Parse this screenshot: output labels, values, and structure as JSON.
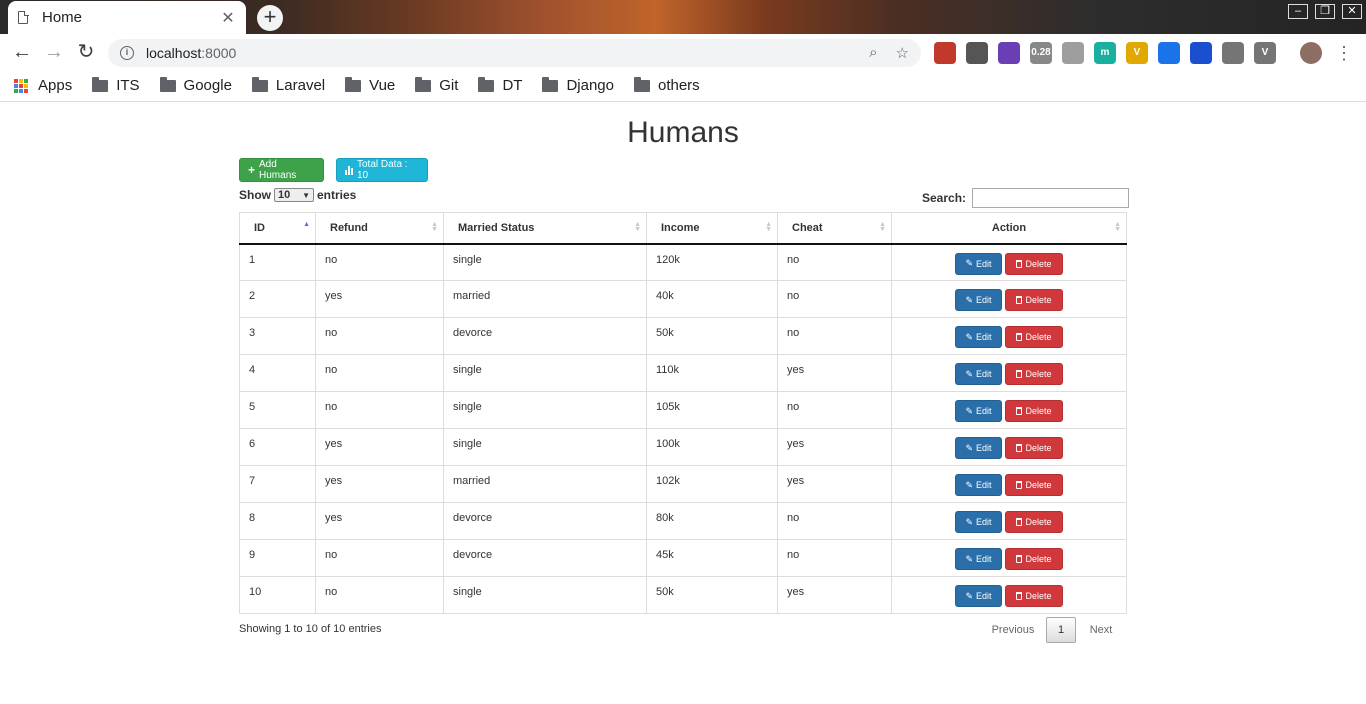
{
  "browser": {
    "tab_title": "Home",
    "tab_close": "✕",
    "new_tab": "+",
    "url_host": "localhost",
    "url_port": ":8000",
    "window_controls": [
      "–",
      "❐",
      "✕"
    ],
    "extensions": [
      {
        "icon": "ublock-icon",
        "color": "#c0392b",
        "label": ""
      },
      {
        "icon": "pen-icon",
        "color": "#555555",
        "label": ""
      },
      {
        "icon": "purple-ext-icon",
        "color": "#6a3fb5",
        "label": ""
      },
      {
        "icon": "counter-ext-icon",
        "color": "#888888",
        "label": "0.28"
      },
      {
        "icon": "cloud-ext-icon",
        "color": "#9e9e9e",
        "label": ""
      },
      {
        "icon": "m-ext-icon",
        "color": "#1ab0a0",
        "label": "m"
      },
      {
        "icon": "vue-devtools-icon",
        "color": "#e0a800",
        "label": "V"
      },
      {
        "icon": "eyedropper-icon",
        "color": "#1a73e8",
        "label": ""
      },
      {
        "icon": "blue-ext-icon",
        "color": "#1a4fd0",
        "label": ""
      },
      {
        "icon": "chat-ext-icon",
        "color": "#757575",
        "label": ""
      },
      {
        "icon": "v-ext-icon",
        "color": "#757575",
        "label": "V"
      }
    ],
    "bookmarks": [
      {
        "label": "Apps",
        "icon": "apps-grid-icon"
      },
      {
        "label": "ITS",
        "icon": "folder-icon"
      },
      {
        "label": "Google",
        "icon": "folder-icon"
      },
      {
        "label": "Laravel",
        "icon": "folder-icon"
      },
      {
        "label": "Vue",
        "icon": "folder-icon"
      },
      {
        "label": "Git",
        "icon": "folder-icon"
      },
      {
        "label": "DT",
        "icon": "folder-icon"
      },
      {
        "label": "Django",
        "icon": "folder-icon"
      },
      {
        "label": "others",
        "icon": "folder-icon"
      }
    ]
  },
  "page": {
    "title": "Humans",
    "add_button": "Add Humans",
    "total_button": "Total Data : 10",
    "show_label": "Show",
    "length_value": "10",
    "entries_label": "entries",
    "search_label": "Search:",
    "info": "Showing 1 to 10 of 10 entries",
    "pager": {
      "previous": "Previous",
      "current": "1",
      "next": "Next"
    }
  },
  "table": {
    "columns": [
      "ID",
      "Refund",
      "Married Status",
      "Income",
      "Cheat",
      "Action"
    ],
    "edit_label": "Edit",
    "delete_label": "Delete",
    "rows": [
      [
        "1",
        "no",
        "single",
        "120k",
        "no"
      ],
      [
        "2",
        "yes",
        "married",
        "40k",
        "no"
      ],
      [
        "3",
        "no",
        "devorce",
        "50k",
        "no"
      ],
      [
        "4",
        "no",
        "single",
        "110k",
        "yes"
      ],
      [
        "5",
        "no",
        "single",
        "105k",
        "no"
      ],
      [
        "6",
        "yes",
        "single",
        "100k",
        "yes"
      ],
      [
        "7",
        "yes",
        "married",
        "102k",
        "yes"
      ],
      [
        "8",
        "yes",
        "devorce",
        "80k",
        "no"
      ],
      [
        "9",
        "no",
        "devorce",
        "45k",
        "no"
      ],
      [
        "10",
        "no",
        "single",
        "50k",
        "yes"
      ]
    ]
  },
  "colors": {
    "success": "#3ea24a",
    "info": "#1fb5d6",
    "primary": "#2a6faa",
    "danger": "#d0383c"
  }
}
